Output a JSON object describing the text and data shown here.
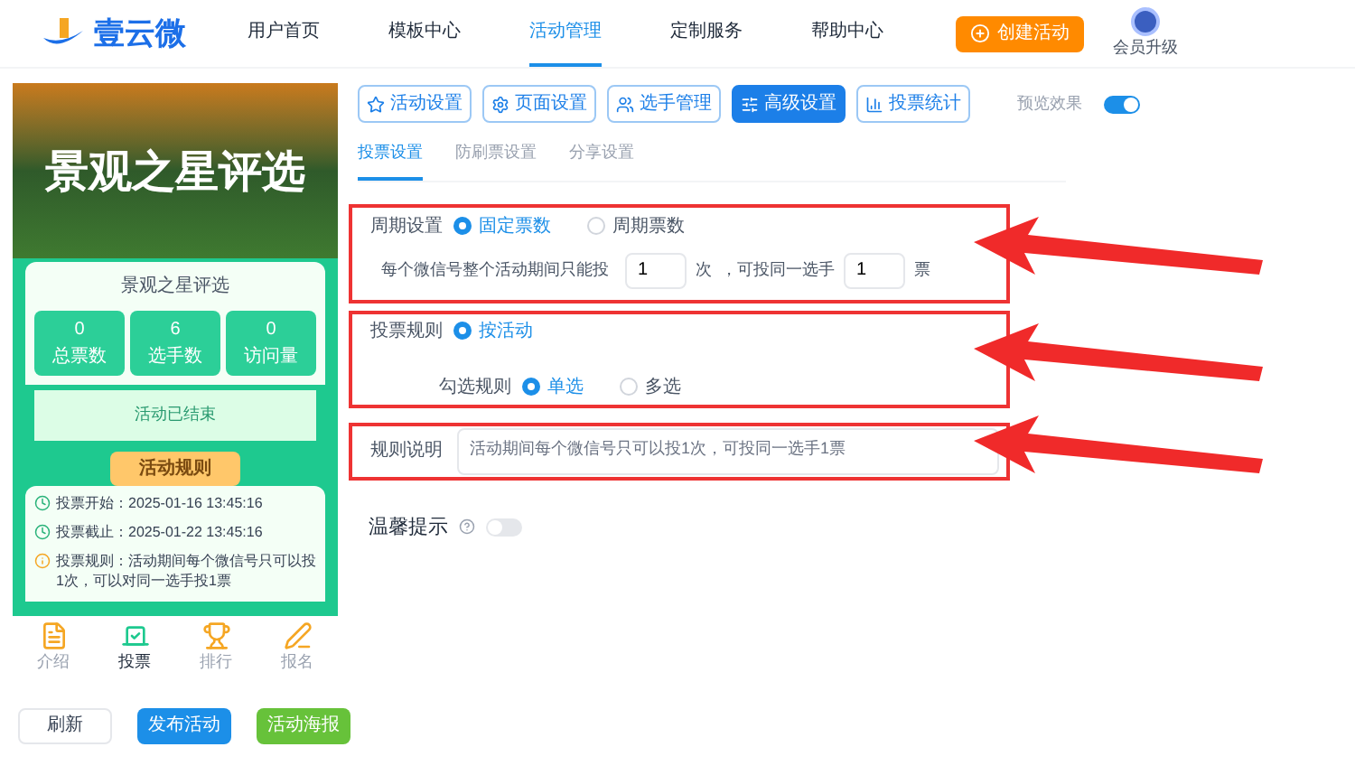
{
  "nav": {
    "logo_text": "壹云微",
    "items": [
      {
        "label": "用户首页",
        "selected": false
      },
      {
        "label": "模板中心",
        "selected": false
      },
      {
        "label": "活动管理",
        "selected": true
      },
      {
        "label": "定制服务",
        "selected": false
      },
      {
        "label": "帮助中心",
        "selected": false
      }
    ],
    "create_button": "创建活动",
    "vip_label": "会员升级"
  },
  "preview": {
    "banner_title": "景观之星评选",
    "card_title": "景观之星评选",
    "stats": [
      {
        "value": "0",
        "label": "总票数"
      },
      {
        "value": "6",
        "label": "选手数"
      },
      {
        "value": "0",
        "label": "访问量"
      }
    ],
    "status": "活动已结束",
    "rules_title": "活动规则",
    "rules": [
      {
        "kind": "clock",
        "label": "投票开始：",
        "value": "2025-01-16 13:45:16"
      },
      {
        "kind": "clock",
        "label": "投票截止：",
        "value": "2025-01-22 13:45:16"
      },
      {
        "kind": "info",
        "label": "投票规则：",
        "value": "活动期间每个微信号只可以投1次，可以对同一选手投1票"
      }
    ],
    "bottom_nav": [
      {
        "kind": "intro",
        "label": "介绍",
        "selected": false
      },
      {
        "kind": "vote",
        "label": "投票",
        "selected": true
      },
      {
        "kind": "rank",
        "label": "排行",
        "selected": false
      },
      {
        "kind": "signup",
        "label": "报名",
        "selected": false
      }
    ]
  },
  "action_buttons": [
    {
      "kind": "plain",
      "label": "刷新"
    },
    {
      "kind": "primary",
      "label": "发布活动"
    },
    {
      "kind": "success",
      "label": "活动海报"
    }
  ],
  "toolbar": [
    {
      "kind": "activity",
      "label": "活动设置",
      "selected": false
    },
    {
      "kind": "page",
      "label": "页面设置",
      "selected": false
    },
    {
      "kind": "players",
      "label": "选手管理",
      "selected": false
    },
    {
      "kind": "advanced",
      "label": "高级设置",
      "selected": true
    },
    {
      "kind": "stats",
      "label": "投票统计",
      "selected": false
    }
  ],
  "preview_toggle": {
    "label": "预览效果",
    "on": true
  },
  "subtabs": [
    {
      "label": "投票设置",
      "selected": true
    },
    {
      "label": "防刷票设置",
      "selected": false
    },
    {
      "label": "分享设置",
      "selected": false
    }
  ],
  "period": {
    "highlighted": true,
    "label": "周期设置",
    "options": [
      {
        "label": "固定票数",
        "selected": true
      },
      {
        "label": "周期票数",
        "selected": false
      }
    ],
    "prefix": "每个微信号整个活动期间只能投",
    "times_value": "1",
    "times_unit": "次",
    "middle": "，可投同一选手",
    "votes_value": "1",
    "votes_unit": "票"
  },
  "vote_rule": {
    "highlighted": true,
    "label": "投票规则",
    "options": [
      {
        "label": "按活动",
        "selected": true
      }
    ],
    "check_label": "勾选规则",
    "check_options": [
      {
        "label": "单选",
        "selected": true
      },
      {
        "label": "多选",
        "selected": false
      }
    ]
  },
  "description": {
    "highlighted": true,
    "label": "规则说明",
    "placeholder": "活动期间每个微信号只可以投1次，可投同一选手1票"
  },
  "tip": {
    "label": "温馨提示",
    "on": false
  }
}
